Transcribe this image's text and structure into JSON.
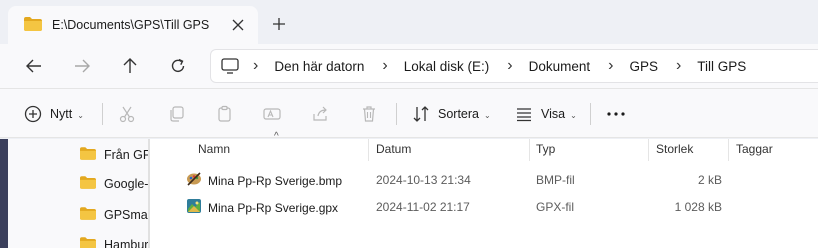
{
  "tab": {
    "title": "E:\\Documents\\GPS\\Till GPS",
    "icon": "folder-icon"
  },
  "nav": {
    "back": "arrow-left-icon",
    "forward": "arrow-right-icon",
    "up": "arrow-up-icon",
    "refresh": "refresh-icon"
  },
  "breadcrumb": [
    "Den här datorn",
    "Lokal disk (E:)",
    "Dokument",
    "GPS",
    "Till GPS"
  ],
  "commands": {
    "new_label": "Nytt",
    "sort_label": "Sortera",
    "view_label": "Visa"
  },
  "sidebar": {
    "items": [
      {
        "label": "Från GPS"
      },
      {
        "label": "Google-"
      },
      {
        "label": "GPSmap"
      },
      {
        "label": "Hamburg"
      }
    ]
  },
  "columns": {
    "name": "Namn",
    "date": "Datum",
    "type": "Typ",
    "size": "Storlek",
    "tags": "Taggar"
  },
  "files": [
    {
      "name": "Mina Pp-Rp Sverige.bmp",
      "date": "2024-10-13 21:34",
      "type": "BMP-fil",
      "size": "2 kB",
      "icon": "paint-image-icon"
    },
    {
      "name": "Mina Pp-Rp Sverige.gpx",
      "date": "2024-11-02 21:17",
      "type": "GPX-fil",
      "size": "1 028 kB",
      "icon": "gpx-map-icon"
    }
  ],
  "colors": {
    "folder": "#f4c542",
    "folder_dark": "#e3a81f",
    "accent": "#3b3f5c",
    "window_bg": "#f9f9fb"
  }
}
